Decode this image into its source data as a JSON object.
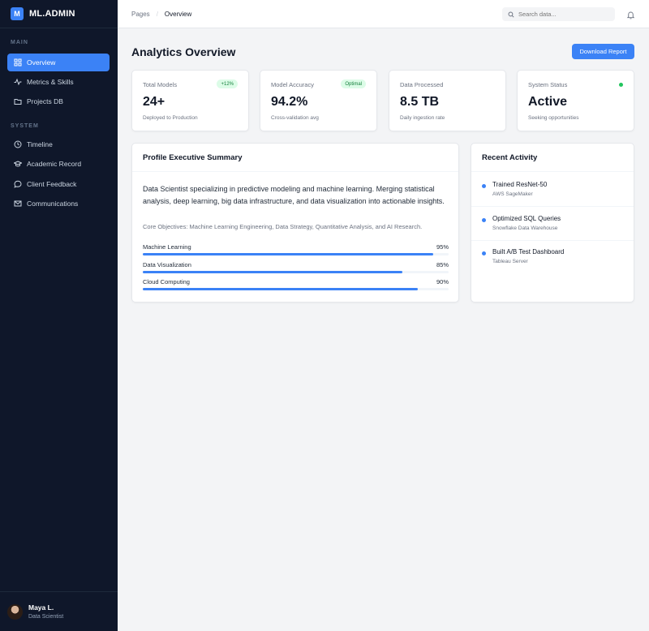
{
  "app": {
    "logo_letter": "M",
    "name": "ML.ADMIN"
  },
  "sidebar": {
    "sections": [
      {
        "label": "MAIN",
        "items": [
          {
            "label": "Overview",
            "icon": "grid-icon",
            "active": true
          },
          {
            "label": "Metrics & Skills",
            "icon": "activity-icon",
            "active": false
          },
          {
            "label": "Projects DB",
            "icon": "folder-icon",
            "active": false
          }
        ]
      },
      {
        "label": "SYSTEM",
        "items": [
          {
            "label": "Timeline",
            "icon": "clock-icon",
            "active": false
          },
          {
            "label": "Academic Record",
            "icon": "graduation-cap-icon",
            "active": false
          },
          {
            "label": "Client Feedback",
            "icon": "message-icon",
            "active": false
          },
          {
            "label": "Communications",
            "icon": "mail-icon",
            "active": false
          }
        ]
      }
    ],
    "user": {
      "name": "Maya L.",
      "role": "Data Scientist"
    }
  },
  "topbar": {
    "breadcrumb": [
      "Pages",
      "Overview"
    ],
    "search_placeholder": "Search data..."
  },
  "main": {
    "title": "Analytics Overview",
    "download_label": "Download Report",
    "stats": [
      {
        "label": "Total Models",
        "value": "24+",
        "sub": "Deployed to Production",
        "badge": "+12%"
      },
      {
        "label": "Model Accuracy",
        "value": "94.2%",
        "sub": "Cross-validation avg",
        "badge": "Optimal"
      },
      {
        "label": "Data Processed",
        "value": "8.5 TB",
        "sub": "Daily ingestion rate"
      },
      {
        "label": "System Status",
        "value": "Active",
        "sub": "Seeking opportunities",
        "status_color": "#22c55e"
      }
    ],
    "profile": {
      "title": "Profile Executive Summary",
      "summary": "Data Scientist specializing in predictive modeling and machine learning. Merging statistical analysis, deep learning, big data infrastructure, and data visualization into actionable insights.",
      "objectives": "Core Objectives: Machine Learning Engineering, Data Strategy, Quantitative Analysis, and AI Research.",
      "skills": [
        {
          "name": "Machine Learning",
          "percent_label": "95%",
          "value": 95
        },
        {
          "name": "Data Visualization",
          "percent_label": "85%",
          "value": 85
        },
        {
          "name": "Cloud Computing",
          "percent_label": "90%",
          "value": 90
        }
      ]
    },
    "activity": {
      "title": "Recent Activity",
      "items": [
        {
          "title": "Trained ResNet-50",
          "sub": "AWS SageMaker"
        },
        {
          "title": "Optimized SQL Queries",
          "sub": "Snowflake Data Warehouse"
        },
        {
          "title": "Built A/B Test Dashboard",
          "sub": "Tableau Server"
        }
      ]
    }
  },
  "colors": {
    "accent": "#3b82f6",
    "sidebar_bg": "#0f172a",
    "success": "#22c55e"
  }
}
